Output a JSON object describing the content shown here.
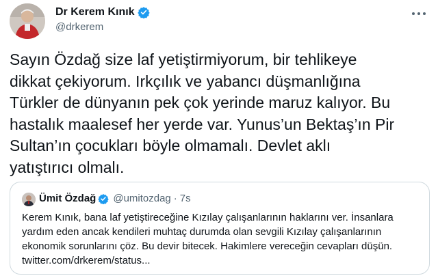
{
  "author": {
    "display_name": "Dr Kerem Kınık",
    "handle": "@drkerem",
    "verified": true
  },
  "tweet": {
    "text": "Sayın Özdağ size laf yetiştirmiyorum, bir tehlikeye\ndikkat çekiyorum. Irkçılık ve yabancı düşmanlığına\nTürkler de dünyanın pek çok yerinde maruz kalıyor. Bu\nhastalık maalesef her yerde var. Yunus’un Bektaş’ın Pir\nSultan’ın çocukları böyle olmamalı. Devlet aklı\nyatıştırıcı olmalı."
  },
  "quoted_tweet": {
    "display_name": "Ümit Özdağ",
    "handle": "@umitozdag",
    "separator": "·",
    "time": "7s",
    "verified": true,
    "text": "Kerem Kınık, bana laf yetiştireceğine Kızılay çalışanlarının haklarını ver. İnsanlara\nyardım eden ancak kendileri muhtaç durumda olan sevgili Kızılay çalışanlarının\nekonomik sorunlarını çöz. Bu devir bitecek. Hakimlere vereceğin cevapları düşün.\ntwitter.com/drkerem/status..."
  },
  "colors": {
    "verified": "#1d9bf0",
    "text": "#0f1419",
    "secondary": "#536471",
    "border": "#cfd9de"
  },
  "icons": {
    "verified": "verified-badge-icon",
    "more": "more-options-icon"
  }
}
